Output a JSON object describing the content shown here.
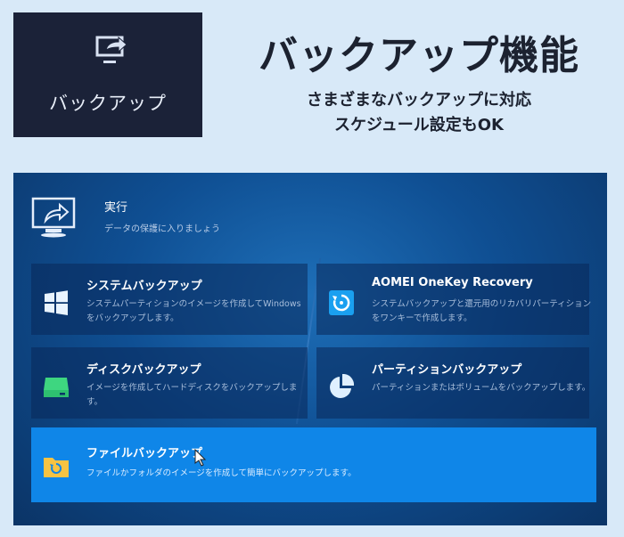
{
  "tile": {
    "label": "バックアップ",
    "icon": "monitor-share-icon"
  },
  "heading": {
    "title": "バックアップ機能",
    "line1": "さまざまなバックアップに対応",
    "line2": "スケジュール設定もOK"
  },
  "panel": {
    "exec": {
      "title": "実行",
      "desc": "データの保護に入りましょう",
      "icon": "monitor-share-icon"
    },
    "cards": [
      {
        "title": "システムバックアップ",
        "desc": "システムパーティションのイメージを作成してWindowsをバックアップします。",
        "icon": "windows-icon"
      },
      {
        "title": "AOMEI OneKey Recovery",
        "desc": "システムバックアップと還元用のリカバリパーティションをワンキーで作成します。",
        "icon": "restore-icon"
      },
      {
        "title": "ディスクバックアップ",
        "desc": "イメージを作成してハードディスクをバックアップします。",
        "icon": "disk-icon"
      },
      {
        "title": "パーティションバックアップ",
        "desc": "パーティションまたはボリュームをバックアップします。",
        "icon": "pie-icon"
      },
      {
        "title": "ファイルバックアップ",
        "desc": "ファイルかフォルダのイメージを作成して簡単にバックアップします。",
        "icon": "folder-sync-icon"
      }
    ]
  },
  "colors": {
    "panel_bg": "#0f4f93",
    "highlight": "#0f86e8",
    "page_bg": "#d8e9f8"
  }
}
